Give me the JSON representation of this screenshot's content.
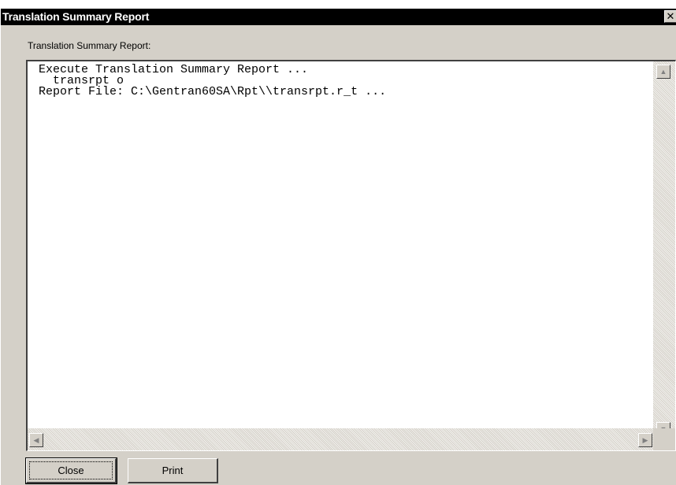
{
  "window": {
    "title": "Translation Summary Report",
    "close_glyph": "✕"
  },
  "report": {
    "label": "Translation Summary Report:",
    "output": "Execute Translation Summary Report ...\n  transrpt o\nReport File: C:\\Gentran60SA\\Rpt\\\\transrpt.r_t ..."
  },
  "scrollbar": {
    "up_glyph": "▲",
    "down_glyph": "▼",
    "left_glyph": "◀",
    "right_glyph": "▶"
  },
  "buttons": {
    "close_label": "Close",
    "print_label": "Print"
  }
}
